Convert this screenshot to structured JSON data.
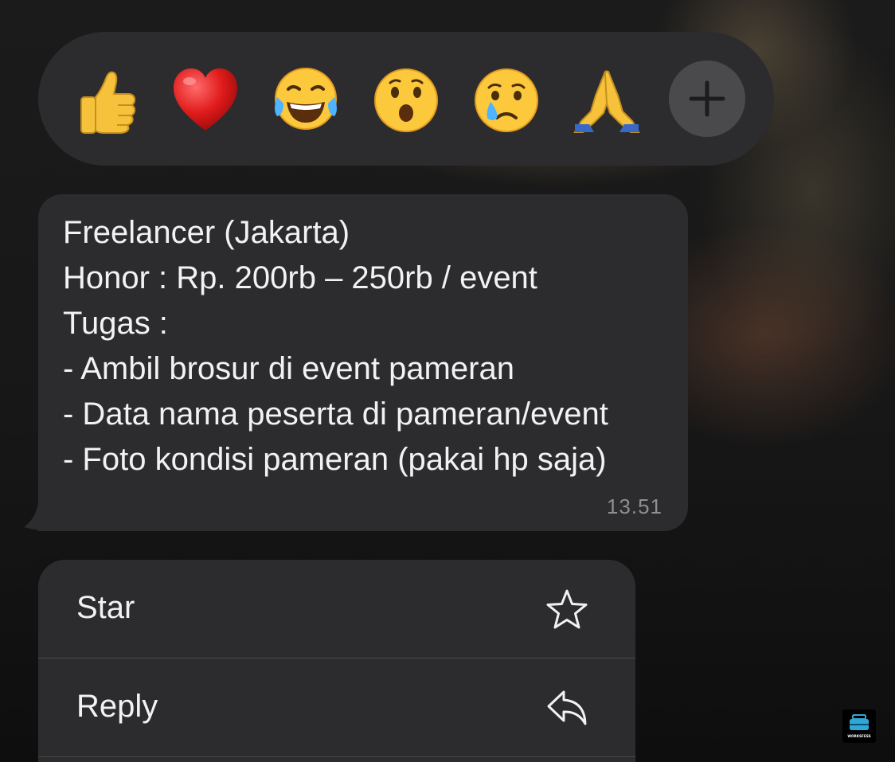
{
  "reactions": {
    "items": [
      {
        "name": "thumbs-up",
        "glyph": "👍"
      },
      {
        "name": "red-heart",
        "glyph": "❤️"
      },
      {
        "name": "face-with-tears-of-joy",
        "glyph": "😂"
      },
      {
        "name": "face-with-open-mouth",
        "glyph": "😮"
      },
      {
        "name": "crying-face",
        "glyph": "😢"
      },
      {
        "name": "folded-hands",
        "glyph": "🙏"
      }
    ],
    "add_icon": "plus-icon"
  },
  "message": {
    "lines": [
      "Freelancer (Jakarta)",
      "Honor : Rp. 200rb – 250rb / event",
      "Tugas :",
      "- Ambil brosur di event pameran",
      "- Data nama peserta di pameran/event",
      "- Foto kondisi pameran (pakai hp saja)"
    ],
    "time": "13.51"
  },
  "menu": {
    "items": [
      {
        "label": "Star",
        "icon": "star-icon"
      },
      {
        "label": "Reply",
        "icon": "reply-icon"
      }
    ]
  },
  "watermark": {
    "text": "WORKSFESS"
  },
  "colors": {
    "surface": "#2c2c2e",
    "text": "#f2f2f2",
    "muted": "#8e8e93",
    "add_button": "#4a4a4d"
  }
}
